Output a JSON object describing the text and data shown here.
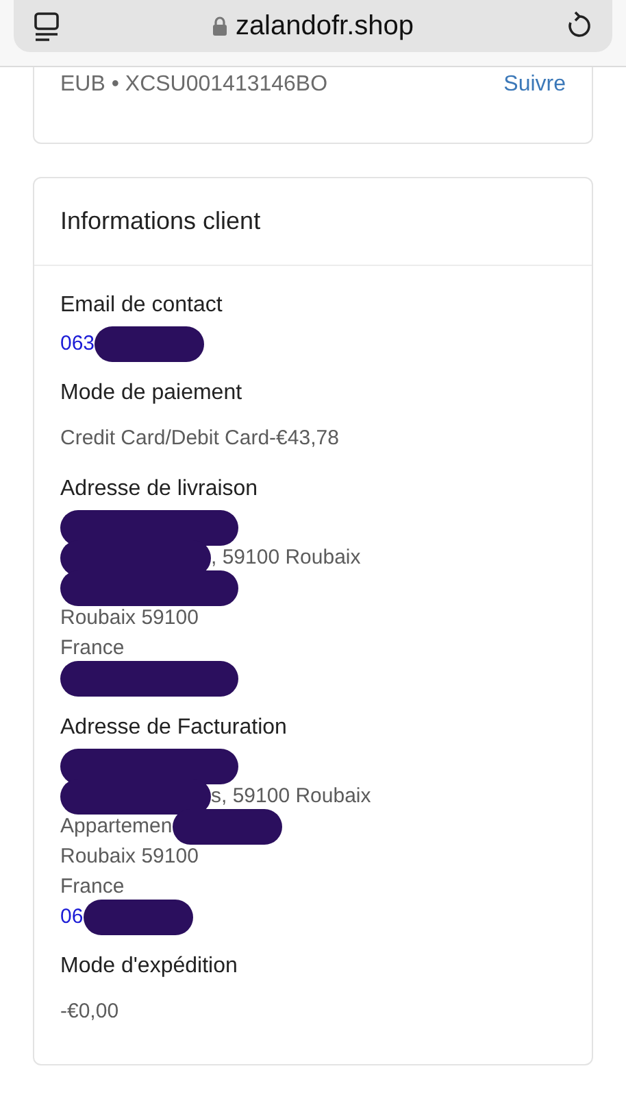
{
  "browser": {
    "url": "zalandofr.shop"
  },
  "tracking": {
    "text": "EUB • XCSU001413146BO",
    "link": "Suivre"
  },
  "card": {
    "title": "Informations client",
    "sections": [
      {
        "kind": "lines",
        "label": "Email de contact",
        "lines": [
          {
            "text": "063",
            "mask_before": false,
            "mask_after": true,
            "link": true
          }
        ]
      },
      {
        "kind": "value",
        "label": "Mode de paiement",
        "value": "Credit Card/Debit Card-€43,78"
      },
      {
        "kind": "lines",
        "label": "Adresse de livraison",
        "lines": [
          {
            "mask_before": true,
            "mask_after": false
          },
          {
            "text": ", 59100 Roubaix",
            "mask_before": true,
            "mask_after": false,
            "link": false
          },
          {
            "mask_before": true,
            "mask_after": false
          },
          {
            "text": "Roubaix 59100",
            "mask_before": false,
            "mask_after": false,
            "link": false
          },
          {
            "text": "France",
            "mask_before": false,
            "mask_after": false,
            "link": false
          },
          {
            "mask_before": true,
            "mask_after": false
          }
        ]
      },
      {
        "kind": "lines",
        "label": "Adresse de Facturation",
        "lines": [
          {
            "mask_before": true,
            "mask_after": false
          },
          {
            "text": "s, 59100 Roubaix",
            "mask_before": true,
            "mask_after": false,
            "link": false
          },
          {
            "text": "Appartemen",
            "mask_before": false,
            "mask_after": true,
            "link": false
          },
          {
            "text": "Roubaix 59100",
            "mask_before": false,
            "mask_after": false,
            "link": false
          },
          {
            "text": "France",
            "mask_before": false,
            "mask_after": false,
            "link": false
          },
          {
            "text": "06",
            "mask_before": false,
            "mask_after": true,
            "link": true
          }
        ]
      },
      {
        "kind": "value",
        "label": "Mode d'expédition",
        "value": "-€0,00"
      }
    ]
  }
}
